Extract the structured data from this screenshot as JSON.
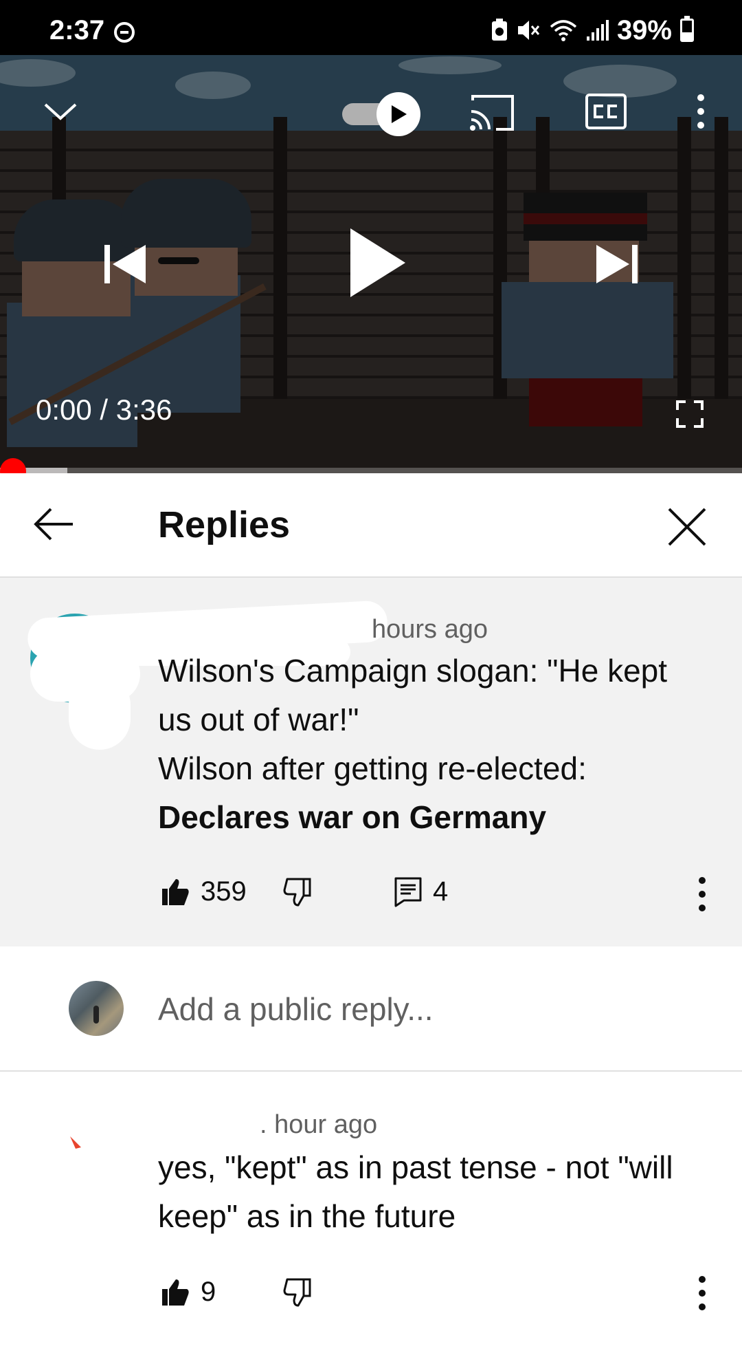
{
  "status_bar": {
    "time": "2:37",
    "battery": "39%"
  },
  "player": {
    "time": "0:00 / 3:36",
    "progress": 0.0
  },
  "replies_panel": {
    "title": "Replies"
  },
  "top_comment": {
    "meta": "hours ago",
    "lines": [
      "Wilson's Campaign slogan: \"He kept",
      "us out of war!\"",
      "Wilson after getting re-elected:"
    ],
    "bold_line": "Declares war on Germany",
    "likes": "359",
    "reply_count": "4"
  },
  "reply_input": {
    "placeholder": "Add a public reply..."
  },
  "replies": [
    {
      "meta": ". hour ago",
      "lines": [
        "yes, \"kept\" as in past tense - not \"will",
        "keep\" as in the future"
      ],
      "likes": "9"
    }
  ],
  "colors": {
    "progress": "#ff0000",
    "comment_bg": "#f2f2f2",
    "muted_text": "#606060"
  }
}
